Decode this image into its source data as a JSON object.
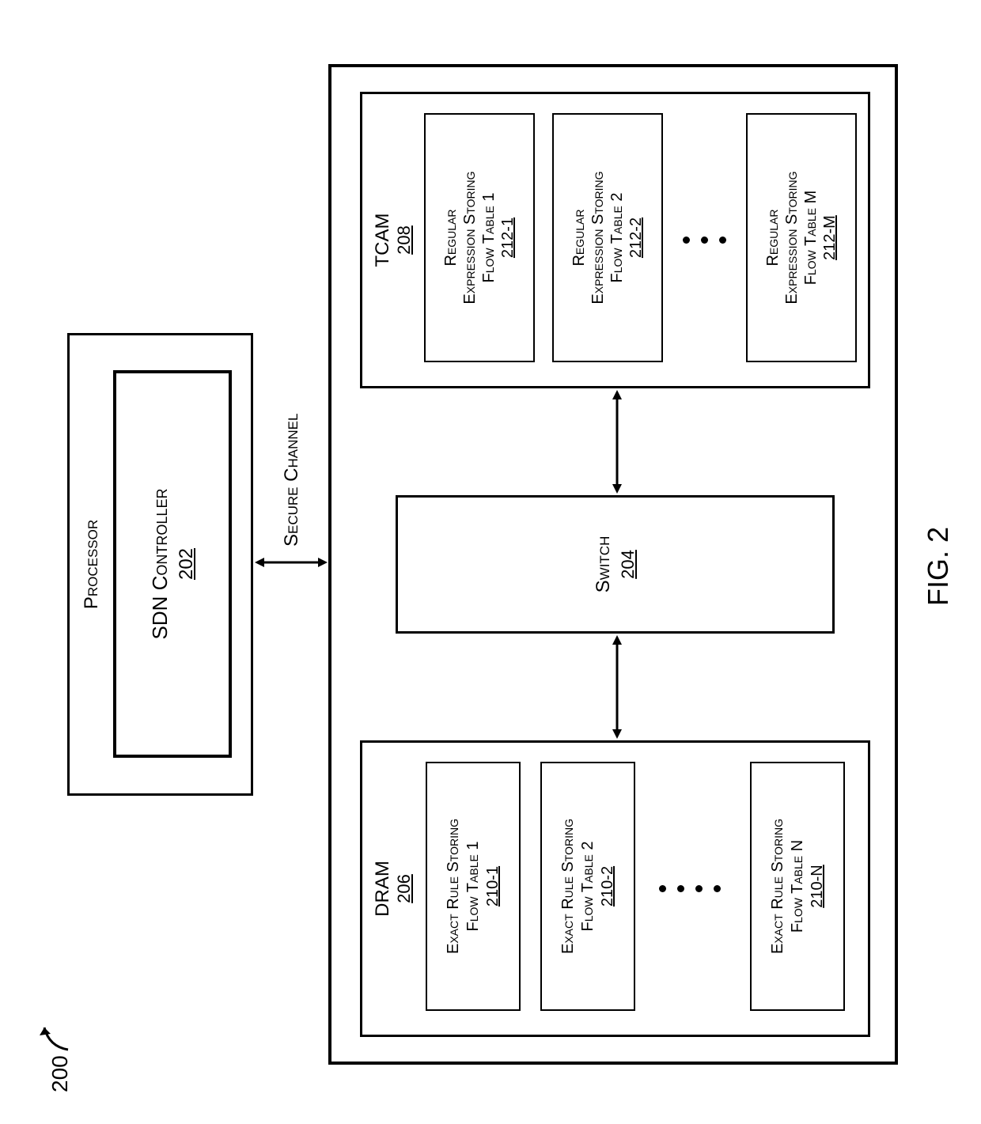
{
  "figure": {
    "ref": "200",
    "caption": "FIG. 2"
  },
  "processor": {
    "title": "Processor",
    "controller": {
      "name": "SDN Controller",
      "ref": "202"
    }
  },
  "channel_label": "Secure Channel",
  "switch": {
    "name": "Switch",
    "ref": "204"
  },
  "dram": {
    "title": "DRAM",
    "ref": "206",
    "tables": [
      {
        "line1": "Exact Rule Storing",
        "line2": "Flow Table 1",
        "ref": "210-1"
      },
      {
        "line1": "Exact Rule Storing",
        "line2": "Flow Table 2",
        "ref": "210-2"
      },
      {
        "line1": "Exact Rule Storing",
        "line2": "Flow Table N",
        "ref": "210-N"
      }
    ]
  },
  "tcam": {
    "title": "TCAM",
    "ref": "208",
    "tables": [
      {
        "line1": "Regular",
        "line2": "Expression Storing",
        "line3": "Flow Table 1",
        "ref": "212-1"
      },
      {
        "line1": "Regular",
        "line2": "Expression Storing",
        "line3": "Flow Table 2",
        "ref": "212-2"
      },
      {
        "line1": "Regular",
        "line2": "Expression Storing",
        "line3": "Flow Table M",
        "ref": "212-M"
      }
    ]
  }
}
